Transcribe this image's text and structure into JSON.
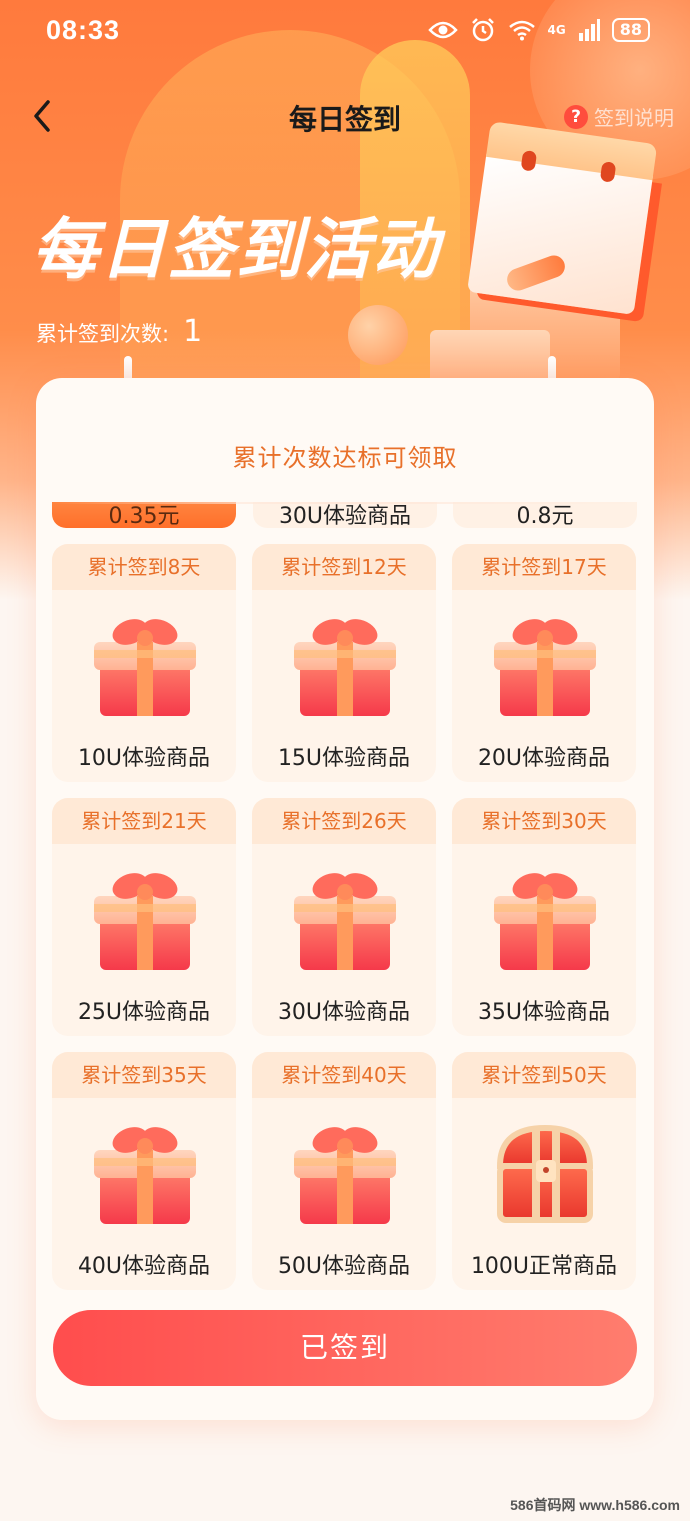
{
  "status_bar": {
    "time": "08:33",
    "network": "4G",
    "battery": "88",
    "icons": [
      "eye-icon",
      "alarm-icon",
      "wifi-icon",
      "signal-icon",
      "battery-icon"
    ]
  },
  "nav": {
    "title": "每日签到",
    "help_label": "签到说明",
    "help_icon": "?"
  },
  "hero": {
    "title": "每日签到活动",
    "streak_label": "累计签到次数:",
    "streak_value": "1"
  },
  "card": {
    "title": "累计次数达标可领取",
    "partial_row": [
      {
        "name": "0.35元",
        "active": true
      },
      {
        "name": "30U体验商品",
        "active": false
      },
      {
        "name": "0.8元",
        "active": false
      }
    ],
    "rewards": [
      {
        "label": "累计签到8天",
        "name": "10U体验商品",
        "icon": "gift-box-icon"
      },
      {
        "label": "累计签到12天",
        "name": "15U体验商品",
        "icon": "gift-box-icon"
      },
      {
        "label": "累计签到17天",
        "name": "20U体验商品",
        "icon": "gift-box-icon"
      },
      {
        "label": "累计签到21天",
        "name": "25U体验商品",
        "icon": "gift-box-icon"
      },
      {
        "label": "累计签到26天",
        "name": "30U体验商品",
        "icon": "gift-box-icon"
      },
      {
        "label": "累计签到30天",
        "name": "35U体验商品",
        "icon": "gift-box-icon"
      },
      {
        "label": "累计签到35天",
        "name": "40U体验商品",
        "icon": "gift-box-icon"
      },
      {
        "label": "累计签到40天",
        "name": "50U体验商品",
        "icon": "gift-box-icon"
      },
      {
        "label": "累计签到50天",
        "name": "100U正常商品",
        "icon": "treasure-chest-icon"
      }
    ],
    "button_label": "已签到"
  },
  "watermark": "586首码网 www.h586.com",
  "colors": {
    "primary_orange": "#ff7a3d",
    "label_orange": "#e8702a",
    "button_red": "#ff4d4d"
  }
}
